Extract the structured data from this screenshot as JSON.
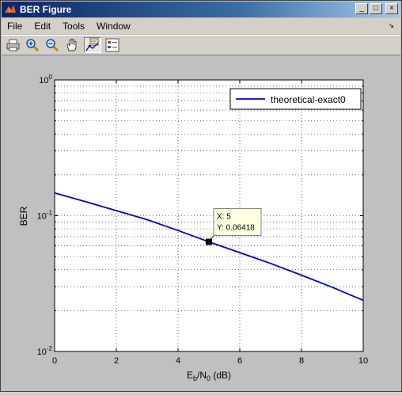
{
  "window": {
    "title": "BER Figure",
    "min_glyph": "_",
    "max_glyph": "□",
    "close_glyph": "×"
  },
  "menu": {
    "items": [
      "File",
      "Edit",
      "Tools",
      "Window"
    ],
    "overflow_glyph": "↘"
  },
  "toolbar": {
    "buttons": [
      {
        "name": "print-icon",
        "pressed": false
      },
      {
        "name": "zoom-in-icon",
        "pressed": false
      },
      {
        "name": "zoom-out-icon",
        "pressed": false
      },
      {
        "name": "pan-hand-icon",
        "pressed": false
      },
      {
        "name": "data-cursor-icon",
        "pressed": true
      },
      {
        "name": "insert-legend-icon",
        "pressed": false
      }
    ]
  },
  "chart_data": {
    "type": "line",
    "xlabel_main": "E",
    "xlabel_sub1": "b",
    "xlabel_mid": "/N",
    "xlabel_sub2": "0",
    "xlabel_tail": " (dB)",
    "ylabel": "BER",
    "xlim": [
      0,
      10
    ],
    "ylim": [
      0.01,
      1
    ],
    "yscale": "log",
    "grid": true,
    "x_ticks": [
      "0",
      "2",
      "4",
      "6",
      "8",
      "10"
    ],
    "y_ticks": [
      {
        "base": "10",
        "exp": "-2"
      },
      {
        "base": "10",
        "exp": "-1"
      },
      {
        "base": "10",
        "exp": "0"
      }
    ],
    "legend": {
      "entries": [
        "theoretical-exact0"
      ],
      "placement": "top-right"
    },
    "series": [
      {
        "name": "theoretical-exact0",
        "color": "#0000cc",
        "x": [
          0,
          1,
          2,
          3,
          4,
          5,
          6,
          7,
          8,
          9,
          10
        ],
        "y": [
          0.147,
          0.127,
          0.109,
          0.0935,
          0.0778,
          0.06418,
          0.0535,
          0.0445,
          0.0365,
          0.0297,
          0.0238
        ]
      }
    ],
    "datatip": {
      "x_text": "X: 5",
      "y_text": "Y: 0.06418",
      "x": 5,
      "y": 0.06418
    }
  }
}
